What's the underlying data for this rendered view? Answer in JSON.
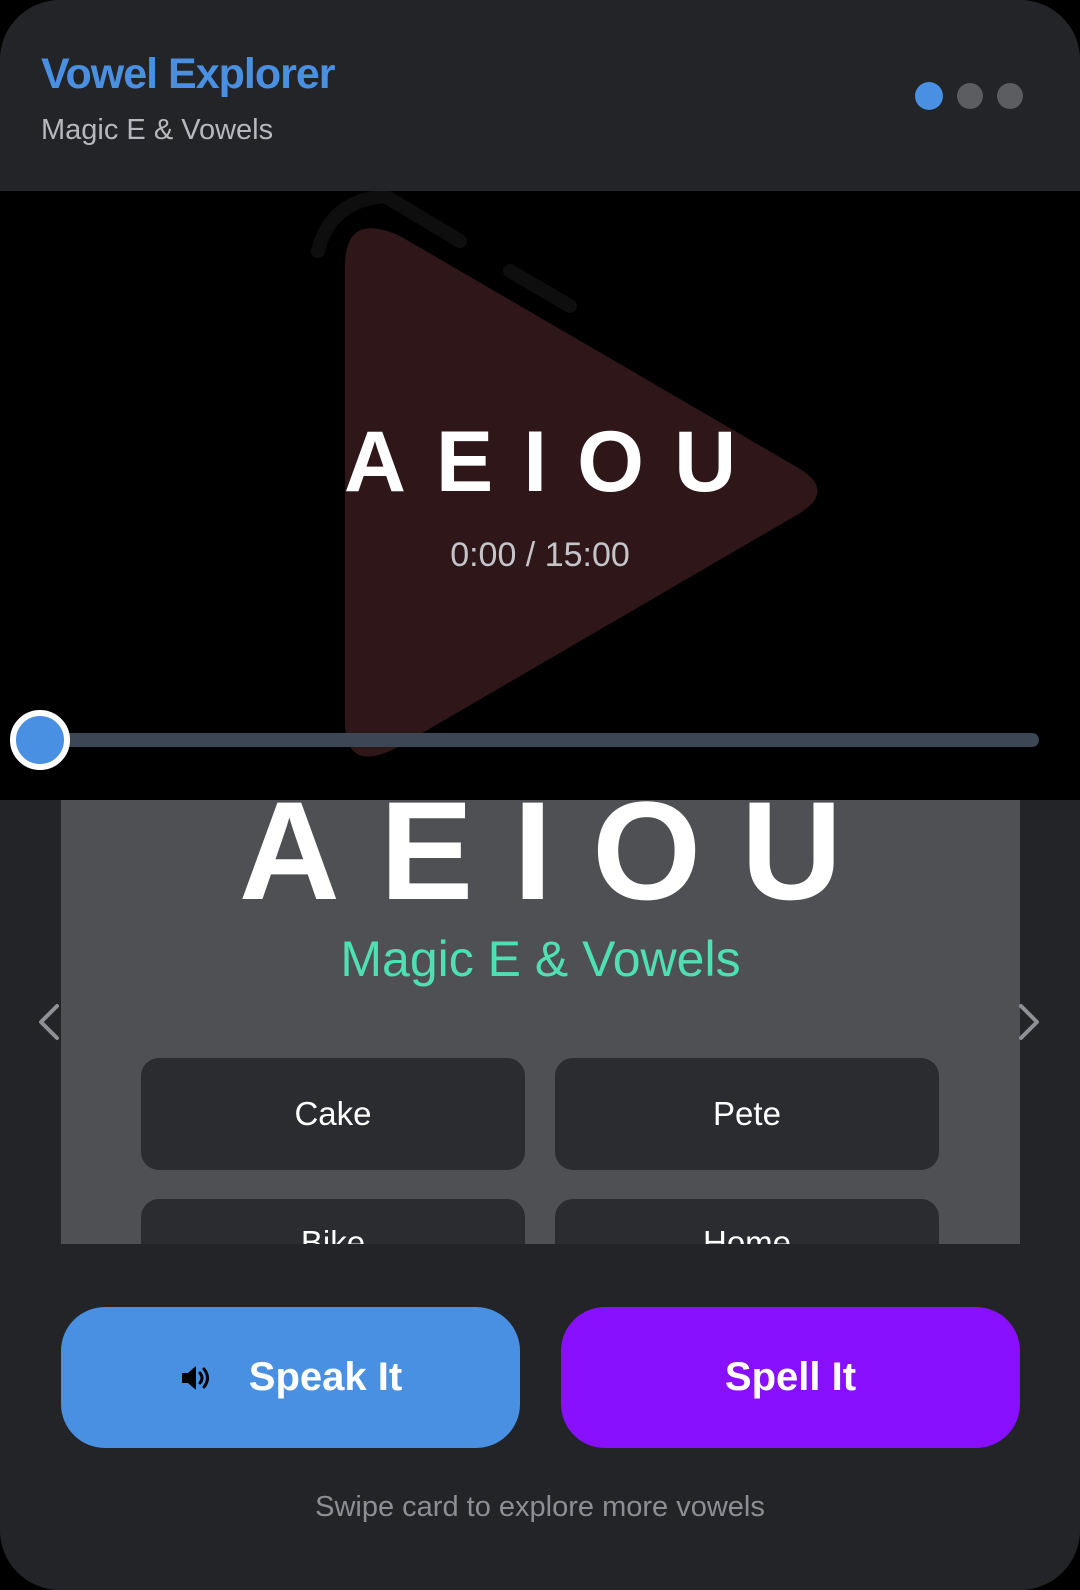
{
  "header": {
    "title": "Vowel Explorer",
    "subtitle": "Magic E & Vowels",
    "pagination": {
      "total": 3,
      "active_index": 0
    }
  },
  "video": {
    "overlay_text": "AEIOU",
    "time_display": "0:00 / 15:00",
    "progress": 0.0
  },
  "card": {
    "letters": "AEIOU",
    "subtitle": "Magic E & Vowels",
    "words": [
      "Cake",
      "Pete",
      "Bike",
      "Home"
    ]
  },
  "actions": {
    "speak_label": "Speak It",
    "spell_label": "Spell It"
  },
  "hint": "Swipe card to explore more vowels",
  "colors": {
    "accent": "#4a90e2",
    "spell": "#8810ff",
    "card_subtitle": "#4fe0b2",
    "background": "#232427"
  },
  "icons": {
    "prev": "chevron-left-icon",
    "next": "chevron-right-icon",
    "speaker": "speaker-icon",
    "play": "play-icon"
  }
}
